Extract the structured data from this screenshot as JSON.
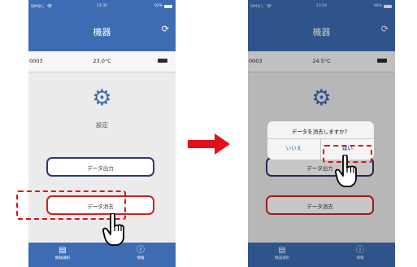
{
  "left_screen": {
    "status": {
      "carrier": "SIMなし",
      "time": "11:31",
      "battery": "92%"
    },
    "title": "機器",
    "device": {
      "id": "0003",
      "temperature": "23.0°C"
    },
    "settings_label": "設定",
    "buttons": {
      "output": "データ出力",
      "erase": "データ消去"
    },
    "nav": {
      "devices": "機器選択",
      "info": "情報"
    }
  },
  "right_screen": {
    "status": {
      "carrier": "SIMなし",
      "time": "13:04",
      "battery": "68%"
    },
    "title": "機器",
    "device": {
      "id": "0003",
      "temperature": "24.5°C"
    },
    "buttons": {
      "output": "データ出力",
      "erase": "データ消去"
    },
    "dialog": {
      "message": "データを消去しますか？",
      "no": "いいえ",
      "yes": "はい"
    },
    "nav": {
      "devices": "機器選択",
      "info": "情報"
    }
  },
  "colors": {
    "header": "#3d6cb3",
    "highlight": "#e0111b",
    "arrow": "#e0111b",
    "dialog_button": "#2a5bb0"
  },
  "icons": [
    "refresh-icon",
    "gear-icon",
    "device-list-icon",
    "info-icon",
    "pointing-hand-icon",
    "right-arrow-icon",
    "wifi-icon"
  ]
}
